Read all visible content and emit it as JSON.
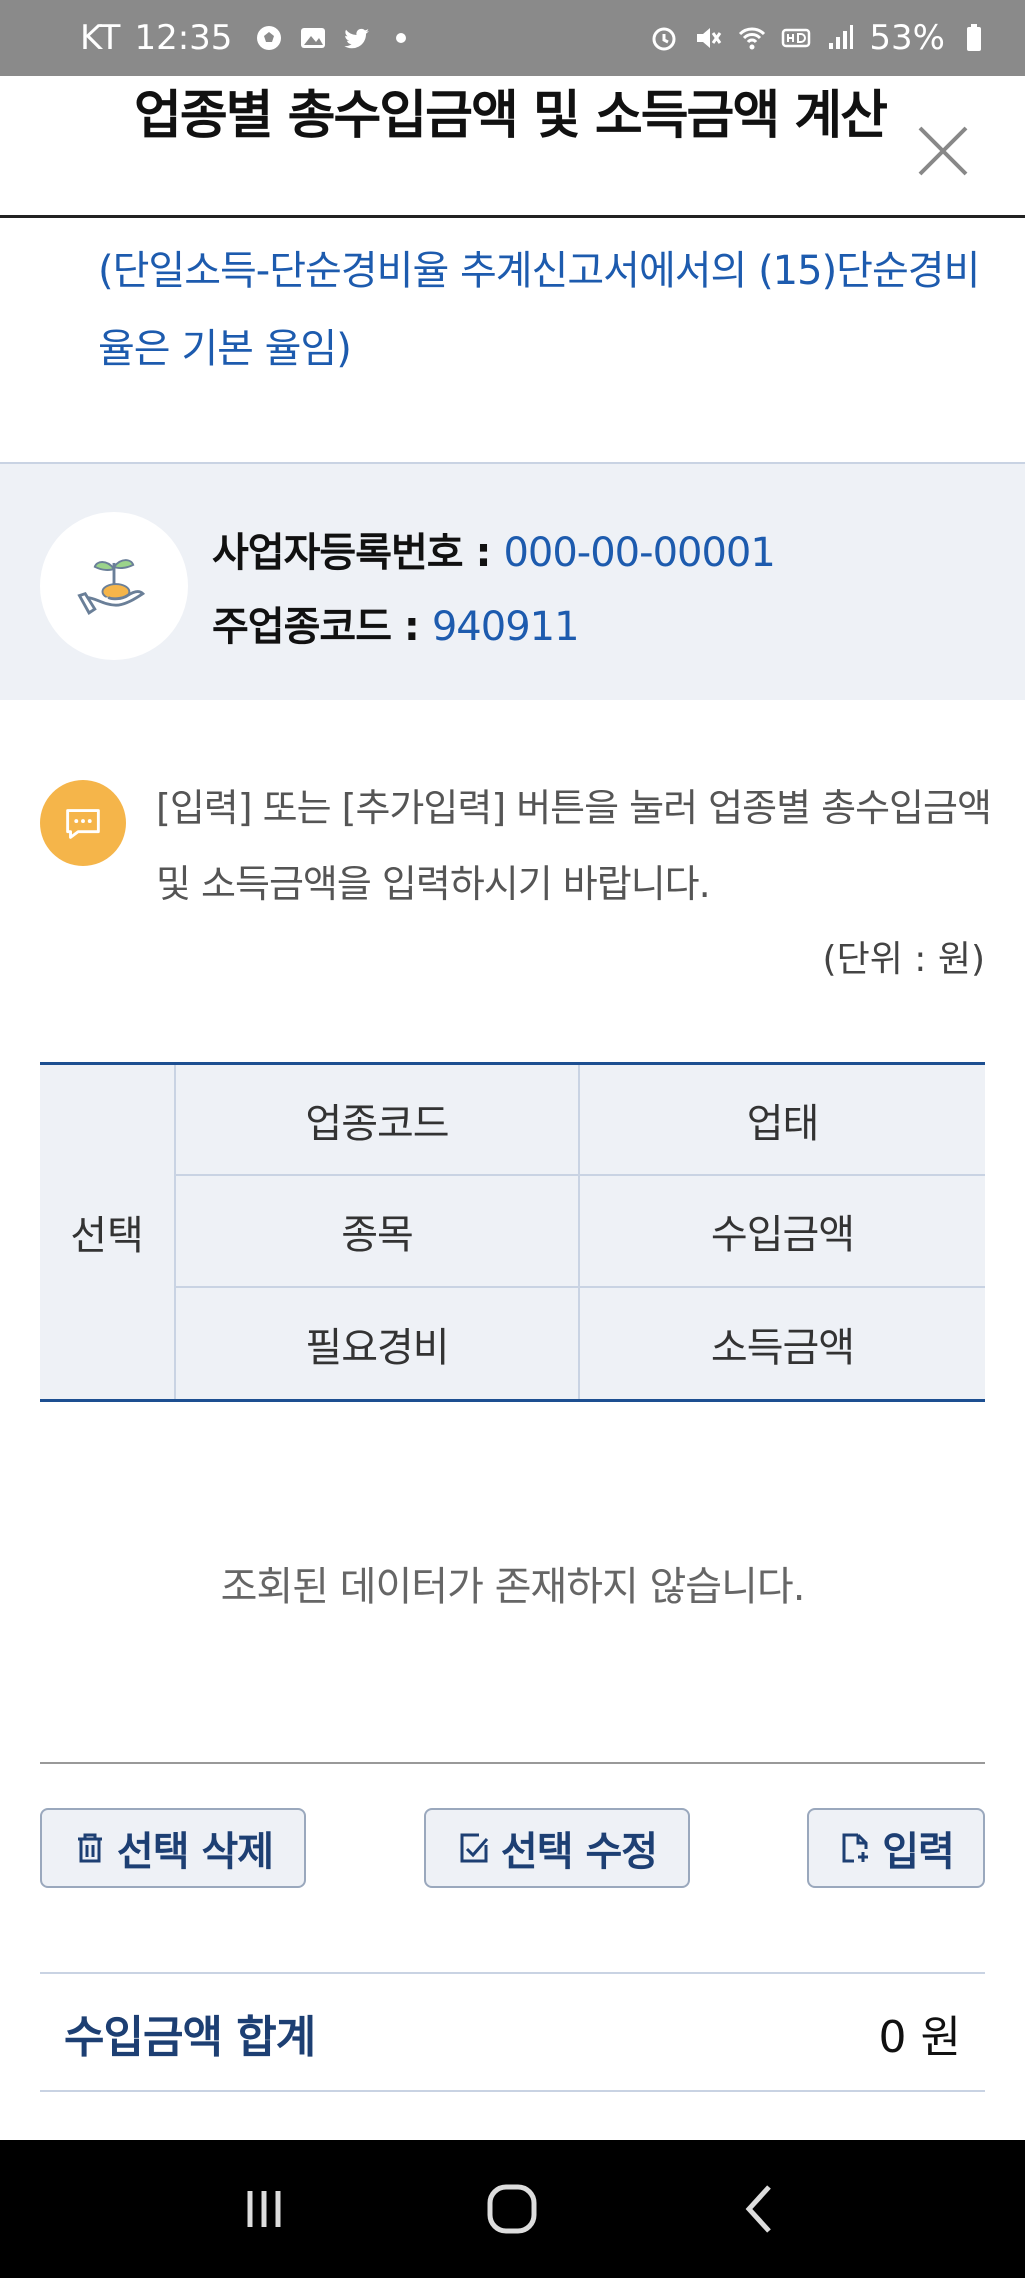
{
  "status_bar": {
    "carrier": "KT",
    "time": "12:35",
    "battery": "53%",
    "icons_left": [
      "soccer-ball-icon",
      "gallery-icon",
      "twitter-icon",
      "dot-icon"
    ],
    "icons_right": [
      "alarm-icon",
      "mute-icon",
      "wifi-icon",
      "hd-icon",
      "signal-icon",
      "battery-icon"
    ]
  },
  "header": {
    "title": "업종별 총수입금액 및 소득금액 계산"
  },
  "notice": {
    "text": "(단일소득-단순경비율 추계신고서에서의 (15)단순경비율은 기본 율임)"
  },
  "business": {
    "reg_label": "사업자등록번호 : ",
    "reg_value": "000-00-00001",
    "code_label": "주업종코드 : ",
    "code_value": "940911"
  },
  "info": {
    "message": "[입력] 또는 [추가입력] 버튼을 눌러 업종별 총수입금액 및 소득금액을 입력하시기 바랍니다.",
    "unit": "(단위 : 원)"
  },
  "table": {
    "select_header": "선택",
    "headers": [
      "업종코드",
      "업태",
      "종목",
      "수입금액",
      "필요경비",
      "소득금액"
    ]
  },
  "empty_message": "조회된 데이터가 존재하지 않습니다.",
  "buttons": {
    "delete": "선택 삭제",
    "edit": "선택 수정",
    "input": "입력"
  },
  "total": {
    "label": "수입금액 합계",
    "value": "0 원"
  },
  "colors": {
    "accent_blue": "#1d5bae",
    "dark_navy": "#1d3f73",
    "info_orange": "#f5b54a",
    "panel_bg": "#eef1f6"
  }
}
